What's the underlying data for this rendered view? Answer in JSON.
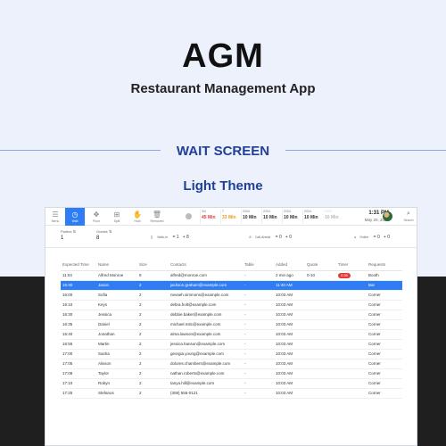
{
  "header": {
    "brand": "AGM",
    "subtitle": "Restaurant Management App",
    "section": "WAIT SCREEN",
    "theme": "Light Theme"
  },
  "toolbar": {
    "buttons": [
      {
        "label": "Menu",
        "icon": "menu-icon"
      },
      {
        "label": "Wait",
        "icon": "clock-icon",
        "active": true
      },
      {
        "label": "Floor",
        "icon": "floor-icon"
      },
      {
        "label": "Split",
        "icon": "split-icon"
      },
      {
        "label": "Hold",
        "icon": "hand-icon"
      },
      {
        "label": "Removed",
        "icon": "trash-icon"
      }
    ],
    "slots": [
      {
        "label": "3/4",
        "value": "45 Min",
        "color": "#e23b3b"
      },
      {
        "label": "7",
        "value": "33 Min",
        "color": "#e89b1e"
      },
      {
        "label": "2/3/4",
        "value": "10 Min"
      },
      {
        "label": "2/3/4",
        "value": "10 Min"
      },
      {
        "label": "2/3/4",
        "value": "10 Min"
      },
      {
        "label": "2/3/4",
        "value": "10 Min"
      },
      {
        "label": "2/3/4",
        "value": "10 Min"
      }
    ],
    "time": "1:31 PM",
    "date": "May 20, 2022",
    "search_label": "Search"
  },
  "stats": {
    "parties_label": "Parties",
    "parties_value": "1",
    "guests_label": "Guests",
    "guests_value": "8",
    "walkin_label": "Walk-In",
    "walkin_eq": "= 1",
    "walkin_plus": "+ 8",
    "callahead_label": "Call-Ahead",
    "callahead_eq": "= 0",
    "callahead_plus": "+ 0",
    "online_label": "Online",
    "online_eq": "= 0",
    "online_plus": "+ 0"
  },
  "table": {
    "columns": [
      "Expected Time",
      "Name",
      "Size",
      "Contacts",
      "Table",
      "Added",
      "Quote",
      "Timer",
      "Requests"
    ],
    "rows": [
      [
        "11:04",
        "Alfred Monroe",
        "8",
        "alfred@monroe.com",
        "-",
        "2 min ago",
        "0-10",
        "2:26",
        "Booth"
      ],
      [
        "15:30",
        "Jason",
        "2",
        "jackson.graham@example.com",
        "-",
        "11:40 AM",
        "",
        "",
        "Bar"
      ],
      [
        "16:00",
        "Sofia",
        "2",
        "nevaeh.simmons@example.com",
        "-",
        "10:03 AM",
        "",
        "",
        "Corner"
      ],
      [
        "16:10",
        "Keys",
        "2",
        "debra.holt@example.com",
        "-",
        "10:03 AM",
        "",
        "",
        "Corner"
      ],
      [
        "16:30",
        "Jessica",
        "2",
        "debbie.baker@example.com",
        "-",
        "10:03 AM",
        "",
        "",
        "Corner"
      ],
      [
        "16:35",
        "Daniel",
        "2",
        "michael.mitc@example.com",
        "-",
        "10:03 AM",
        "",
        "",
        "Corner"
      ],
      [
        "16:40",
        "Jonathan",
        "2",
        "alma.lawson@example.com",
        "-",
        "10:03 AM",
        "",
        "",
        "Corner"
      ],
      [
        "16:55",
        "Martin",
        "2",
        "jessica.hanson@example.com",
        "-",
        "10:03 AM",
        "",
        "",
        "Corner"
      ],
      [
        "17:00",
        "Sasha",
        "2",
        "georgia.young@example.com",
        "-",
        "10:03 AM",
        "",
        "",
        "Corner"
      ],
      [
        "17:05",
        "Alisson",
        "2",
        "dolores.chambers@example.com",
        "-",
        "10:03 AM",
        "",
        "",
        "Corner"
      ],
      [
        "17:08",
        "Taylor",
        "2",
        "nathan.roberts@example.com",
        "-",
        "10:03 AM",
        "",
        "",
        "Corner"
      ],
      [
        "17:10",
        "Robyn",
        "2",
        "tanya.hill@example.com",
        "-",
        "10:03 AM",
        "",
        "",
        "Corner"
      ],
      [
        "17:25",
        "Stefanos",
        "2",
        "(308) 555-0121",
        "-",
        "10:03 AM",
        "",
        "",
        "Corner"
      ]
    ],
    "selected_row": 1
  }
}
